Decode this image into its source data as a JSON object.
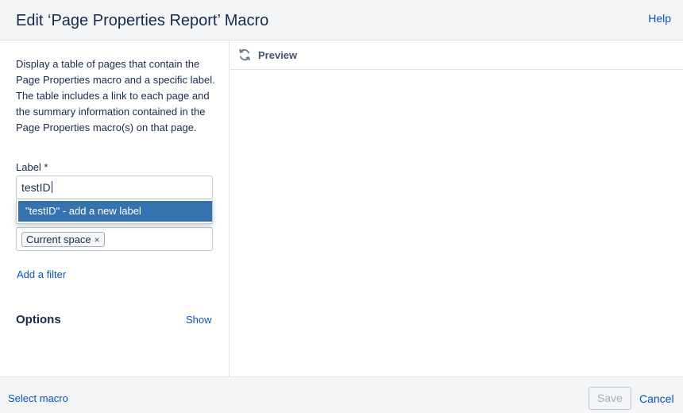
{
  "dialog": {
    "title": "Edit ‘Page Properties Report’ Macro",
    "help_label": "Help"
  },
  "left_panel": {
    "description": "Display a table of pages that contain the Page Properties macro and a specific label. The table includes a link to each page and the summary information contained in the Page Properties macro(s) on that page.",
    "label_field": {
      "label": "Label *",
      "value": "testID"
    },
    "suggestion": "\"testID\" - add a new label",
    "space_field": {
      "token": "Current space",
      "remove_glyph": "×"
    },
    "add_filter_label": "Add a filter",
    "options": {
      "heading": "Options",
      "show_label": "Show"
    }
  },
  "preview": {
    "label": "Preview",
    "icon": "refresh-icon"
  },
  "footer": {
    "select_macro_label": "Select macro",
    "save_label": "Save",
    "cancel_label": "Cancel"
  },
  "colors": {
    "link": "#0052cc",
    "highlight": "#3572b0",
    "header_bg": "#f4f5f7",
    "text": "#172b4d"
  }
}
